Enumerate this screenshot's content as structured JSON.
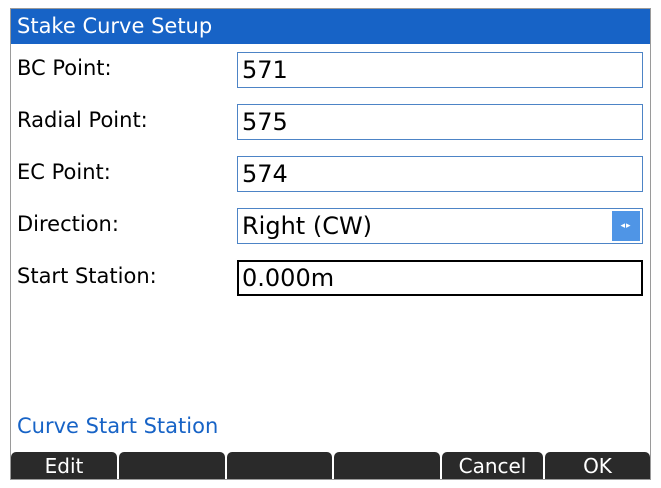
{
  "window": {
    "title": "Stake Curve Setup"
  },
  "form": {
    "bc_point": {
      "label": "BC Point:",
      "value": "571"
    },
    "radial_point": {
      "label": "Radial Point:",
      "value": "575"
    },
    "ec_point": {
      "label": "EC Point:",
      "value": "574"
    },
    "direction": {
      "label": "Direction:",
      "value": "Right (CW)",
      "arrows": "◂▸"
    },
    "start_station": {
      "label": "Start Station:",
      "value": "0.000m"
    }
  },
  "hint": "Curve Start Station",
  "softkeys": [
    "Edit",
    "",
    "",
    "",
    "Cancel",
    "OK"
  ],
  "colors": {
    "title_bg": "#1763c6",
    "hint": "#1763c6",
    "field_border": "#4d84c6",
    "softkey_bg": "#2a2a2a"
  }
}
